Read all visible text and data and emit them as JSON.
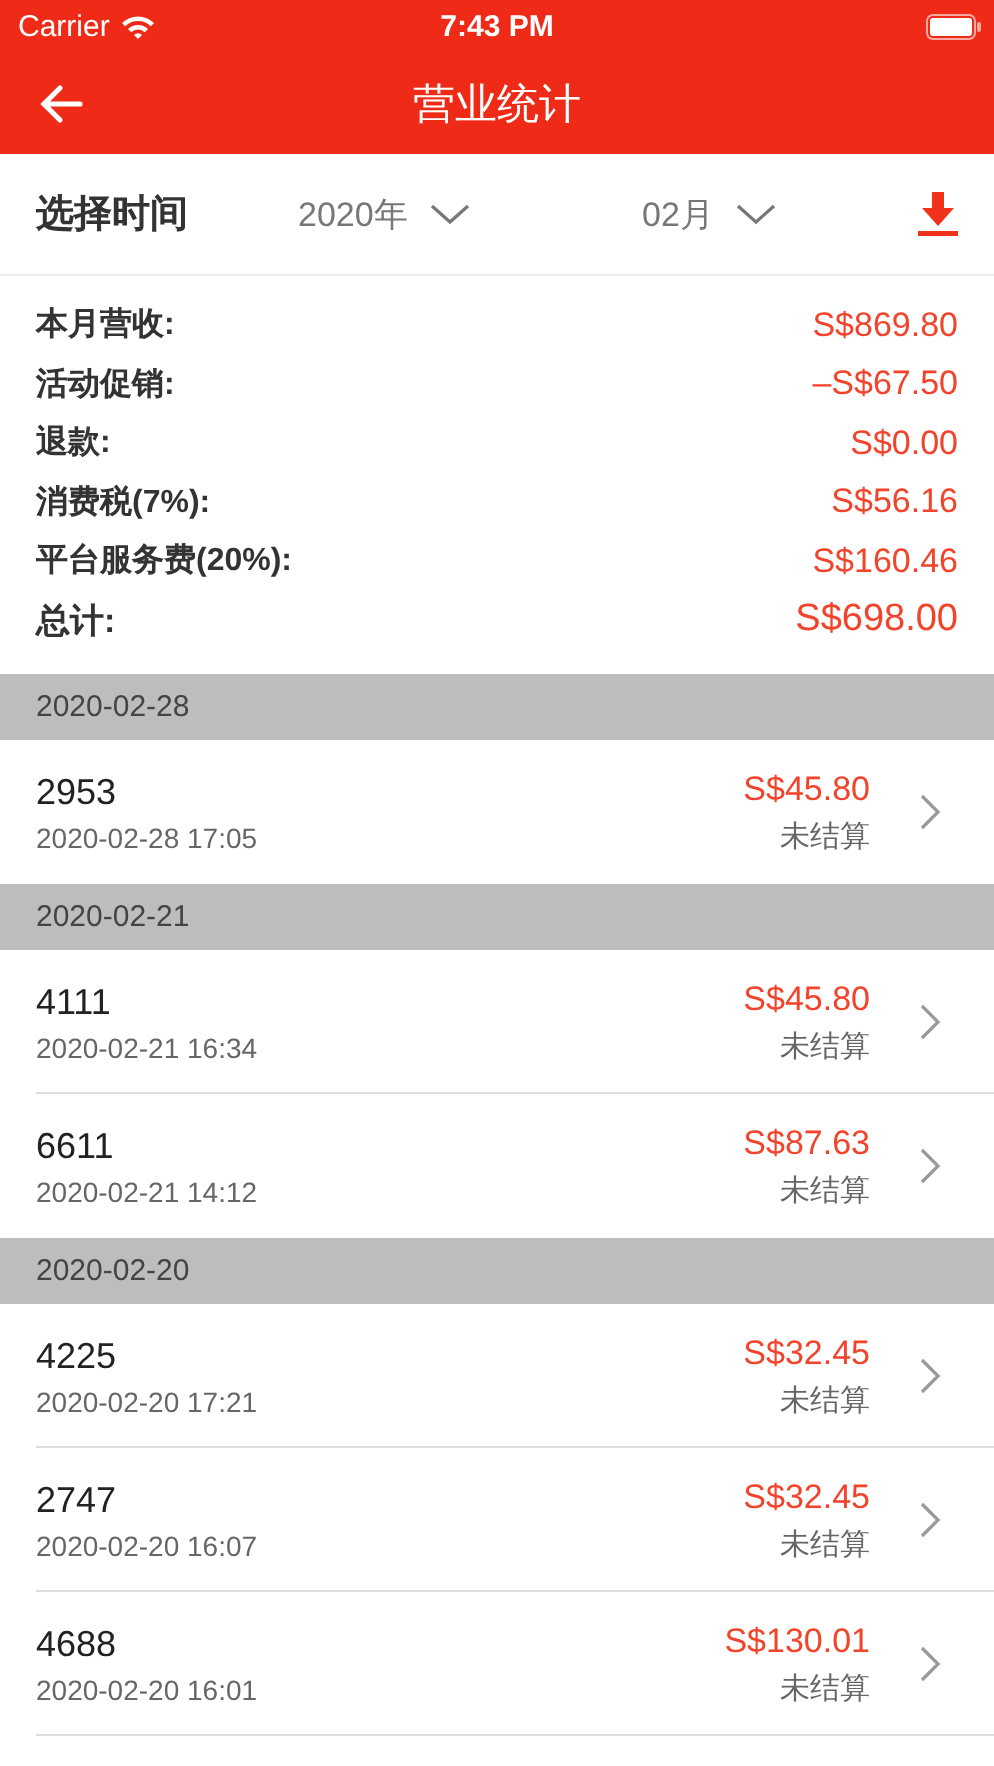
{
  "status_bar": {
    "carrier": "Carrier",
    "time": "7:43 PM"
  },
  "nav": {
    "title": "营业统计"
  },
  "selector": {
    "label": "选择时间",
    "year": "2020年",
    "month": "02月"
  },
  "summary": [
    {
      "kind": "line",
      "label": "本月营收:",
      "value": "S$869.80"
    },
    {
      "kind": "line",
      "label": "活动促销:",
      "value": "–S$67.50"
    },
    {
      "kind": "line",
      "label": "退款:",
      "value": "S$0.00"
    },
    {
      "kind": "line",
      "label": "消费税(7%):",
      "value": "S$56.16"
    },
    {
      "kind": "line",
      "label": "平台服务费(20%):",
      "value": "S$160.46"
    },
    {
      "kind": "total",
      "label": "总计:",
      "value": "S$698.00"
    }
  ],
  "groups": [
    {
      "date": "2020-02-28",
      "orders": [
        {
          "number": "2953",
          "time": "2020-02-28 17:05",
          "amount": "S$45.80",
          "status": "未结算"
        }
      ]
    },
    {
      "date": "2020-02-21",
      "orders": [
        {
          "number": "4111",
          "time": "2020-02-21 16:34",
          "amount": "S$45.80",
          "status": "未结算"
        },
        {
          "number": "6611",
          "time": "2020-02-21 14:12",
          "amount": "S$87.63",
          "status": "未结算"
        }
      ]
    },
    {
      "date": "2020-02-20",
      "orders": [
        {
          "number": "4225",
          "time": "2020-02-20 17:21",
          "amount": "S$32.45",
          "status": "未结算"
        },
        {
          "number": "2747",
          "time": "2020-02-20 16:07",
          "amount": "S$32.45",
          "status": "未结算"
        },
        {
          "number": "4688",
          "time": "2020-02-20 16:01",
          "amount": "S$130.01",
          "status": "未结算"
        }
      ]
    }
  ]
}
